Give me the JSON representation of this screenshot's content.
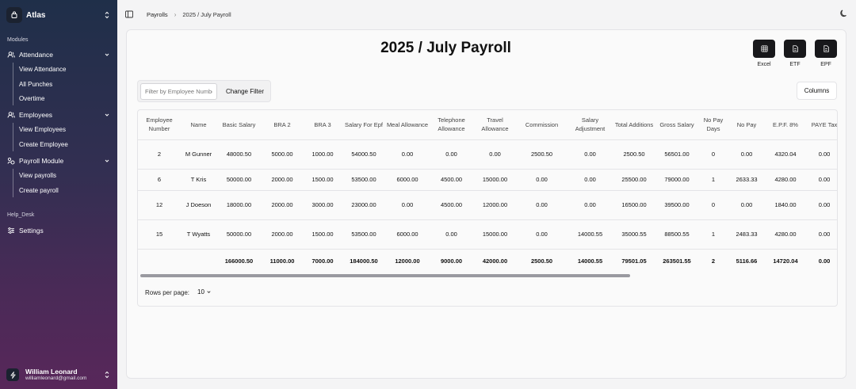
{
  "app": {
    "name": "Atlas"
  },
  "sidebar": {
    "modules_label": "Modules",
    "groups": [
      {
        "label": "Attendance",
        "icon": "users-icon",
        "items": [
          "View Attendance",
          "All Punches",
          "Overtime"
        ]
      },
      {
        "label": "Employees",
        "icon": "users-icon",
        "items": [
          "View Employees",
          "Create Employee"
        ]
      },
      {
        "label": "Payroll Module",
        "icon": "payroll-icon",
        "items": [
          "View payrolls",
          "Create payroll"
        ]
      }
    ],
    "helpdesk_label": "Help_Desk",
    "settings_label": "Settings"
  },
  "user": {
    "name": "William Leonard",
    "email": "williamleonard@gmail.com"
  },
  "breadcrumb": {
    "root": "Payrolls",
    "current": "2025 / July Payroll"
  },
  "page": {
    "title": "2025 / July Payroll"
  },
  "exports": [
    {
      "label": "Excel",
      "icon": "table-icon"
    },
    {
      "label": "ETF",
      "icon": "file-icon"
    },
    {
      "label": "EPF",
      "icon": "file-icon"
    }
  ],
  "filter": {
    "placeholder": "Filter by Employee Number",
    "button": "Change Filter"
  },
  "columns_button": "Columns",
  "table": {
    "headers": [
      "Employee Number",
      "Name",
      "Basic Salary",
      "BRA 2",
      "BRA 3",
      "Salary For Epf",
      "Meal Allowance",
      "Telephone Allowance",
      "Travel Allowance",
      "Commission",
      "Salary Adjustment",
      "Total Additions",
      "Gross Salary",
      "No Pay Days",
      "No Pay",
      "E.P.F. 8%",
      "PAYE Tax"
    ],
    "rows": [
      [
        "2",
        "M Gunner",
        "48000.50",
        "5000.00",
        "1000.00",
        "54000.50",
        "0.00",
        "0.00",
        "0.00",
        "2500.50",
        "0.00",
        "2500.50",
        "56501.00",
        "0",
        "0.00",
        "4320.04",
        "0.00"
      ],
      [
        "6",
        "T Kris",
        "50000.00",
        "2000.00",
        "1500.00",
        "53500.00",
        "6000.00",
        "4500.00",
        "15000.00",
        "0.00",
        "0.00",
        "25500.00",
        "79000.00",
        "1",
        "2633.33",
        "4280.00",
        "0.00"
      ],
      [
        "12",
        "J Doeson",
        "18000.00",
        "2000.00",
        "3000.00",
        "23000.00",
        "0.00",
        "4500.00",
        "12000.00",
        "0.00",
        "0.00",
        "16500.00",
        "39500.00",
        "0",
        "0.00",
        "1840.00",
        "0.00"
      ],
      [
        "15",
        "T Wyatts",
        "50000.00",
        "2000.00",
        "1500.00",
        "53500.00",
        "6000.00",
        "0.00",
        "15000.00",
        "0.00",
        "14000.55",
        "35000.55",
        "88500.55",
        "1",
        "2483.33",
        "4280.00",
        "0.00"
      ]
    ],
    "totals": [
      "",
      "",
      "166000.50",
      "11000.00",
      "7000.00",
      "184000.50",
      "12000.00",
      "9000.00",
      "42000.00",
      "2500.50",
      "14000.55",
      "79501.05",
      "263501.55",
      "2",
      "5116.66",
      "14720.04",
      "0.00"
    ]
  },
  "pagination": {
    "rows_per_page_label": "Rows per page:",
    "rows_per_page_value": "10"
  }
}
